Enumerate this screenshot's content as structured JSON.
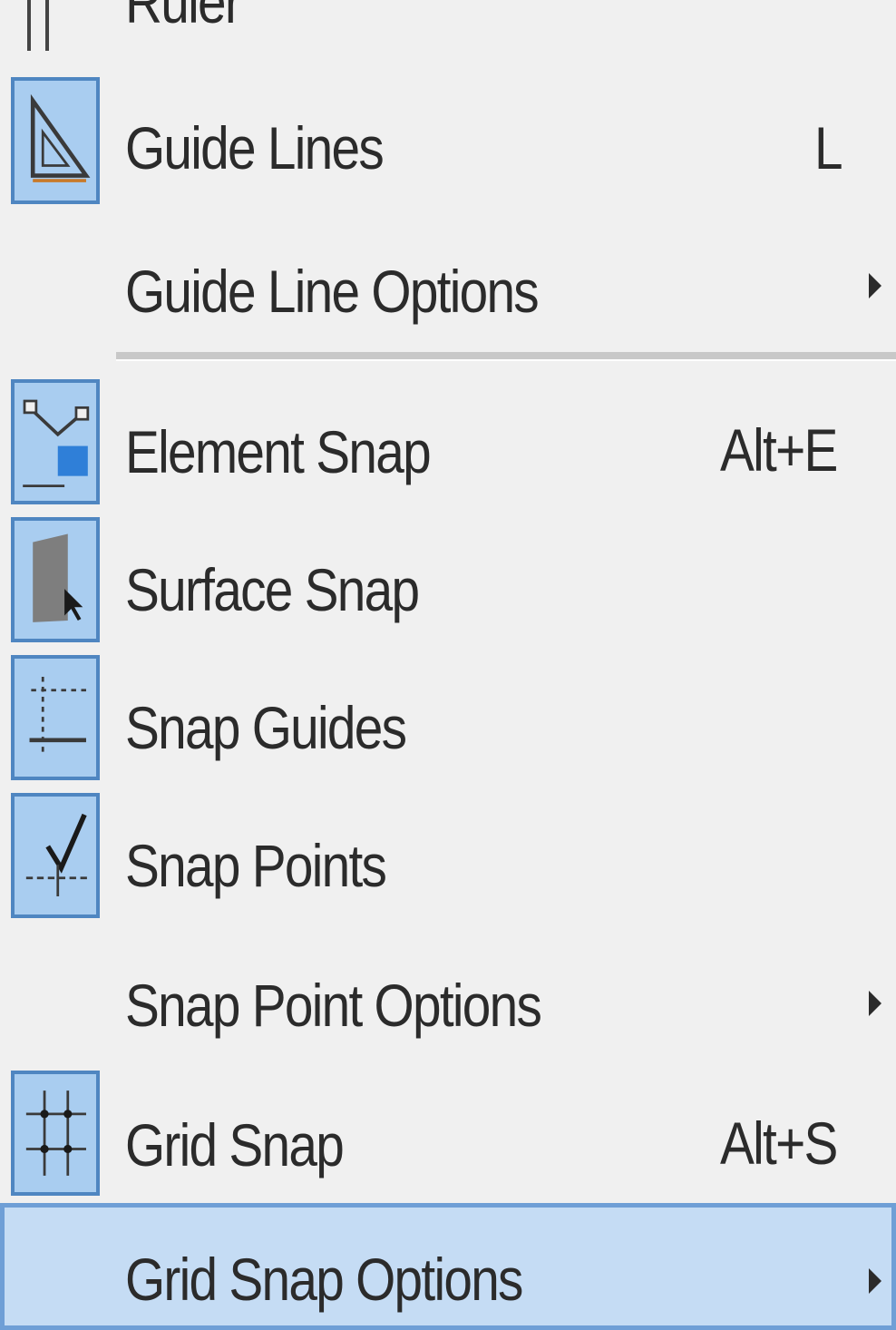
{
  "menu": {
    "items": [
      {
        "label": "Ruler"
      },
      {
        "label": "Guide Lines",
        "shortcut": "L",
        "icon": "set-square-icon"
      },
      {
        "label": "Guide Line Options",
        "submenu": true
      },
      {
        "label": "Element Snap",
        "shortcut": "Alt+E",
        "icon": "element-snap-icon"
      },
      {
        "label": "Surface Snap",
        "icon": "surface-snap-icon"
      },
      {
        "label": "Snap Guides",
        "icon": "snap-guides-icon"
      },
      {
        "label": "Snap Points",
        "icon": "snap-points-icon"
      },
      {
        "label": "Snap Point Options",
        "submenu": true
      },
      {
        "label": "Grid Snap",
        "shortcut": "Alt+S",
        "icon": "grid-snap-icon"
      },
      {
        "label": "Grid Snap Options",
        "submenu": true,
        "highlighted": true
      }
    ]
  },
  "colors": {
    "menu_bg": "#f0f0f0",
    "icon_active_bg": "#a9cdf0",
    "icon_active_border": "#4f86c1",
    "highlight_bg": "#c5dcf4",
    "highlight_border": "#6f9fd6",
    "text": "#2b2b2b"
  }
}
